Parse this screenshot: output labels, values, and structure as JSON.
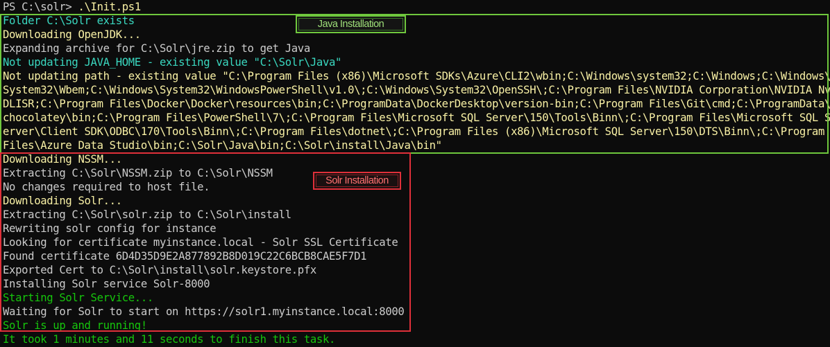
{
  "prompt": {
    "prefix": "PS C:\\solr> ",
    "command": ".\\Init.ps1"
  },
  "annotations": {
    "java_label": "Java Installation",
    "solr_label": "Solr Installation"
  },
  "output": [
    {
      "text": "Folder C:\\Solr exists",
      "color": "cyan"
    },
    {
      "text": "Downloading OpenJDK...",
      "color": "yellow"
    },
    {
      "text": "Expanding archive for C:\\Solr\\jre.zip to get Java",
      "color": "white"
    },
    {
      "text": "Not updating JAVA_HOME - existing value \"C:\\Solr\\Java\"",
      "color": "cyan"
    },
    {
      "text": "Not updating path - existing value \"C:\\Program Files (x86)\\Microsoft SDKs\\Azure\\CLI2\\wbin;C:\\Windows\\system32;C:\\Windows;C:\\Windows\\",
      "color": "yellow"
    },
    {
      "text": "System32\\Wbem;C:\\Windows\\System32\\WindowsPowerShell\\v1.0\\;C:\\Windows\\System32\\OpenSSH\\;C:\\Program Files\\NVIDIA Corporation\\NVIDIA Nv",
      "color": "yellow"
    },
    {
      "text": "DLISR;C:\\Program Files\\Docker\\Docker\\resources\\bin;C:\\ProgramData\\DockerDesktop\\version-bin;C:\\Program Files\\Git\\cmd;C:\\ProgramData\\",
      "color": "yellow"
    },
    {
      "text": "chocolatey\\bin;C:\\Program Files\\PowerShell\\7\\;C:\\Program Files\\Microsoft SQL Server\\150\\Tools\\Binn\\;C:\\Program Files\\Microsoft SQL S",
      "color": "yellow"
    },
    {
      "text": "erver\\Client SDK\\ODBC\\170\\Tools\\Binn\\;C:\\Program Files\\dotnet\\;C:\\Program Files (x86)\\Microsoft SQL Server\\150\\DTS\\Binn\\;C:\\Program",
      "color": "yellow"
    },
    {
      "text": "Files\\Azure Data Studio\\bin;C:\\Solr\\Java\\bin;C:\\Solr\\install\\Java\\bin\"",
      "color": "yellow"
    },
    {
      "text": "Downloading NSSM...",
      "color": "yellow"
    },
    {
      "text": "Extracting C:\\Solr\\NSSM.zip to C:\\Solr\\NSSM",
      "color": "white"
    },
    {
      "text": "No changes required to host file.",
      "color": "white"
    },
    {
      "text": "Downloading Solr...",
      "color": "yellow"
    },
    {
      "text": "Extracting C:\\Solr\\solr.zip to C:\\Solr\\install",
      "color": "white"
    },
    {
      "text": "Rewriting solr config for instance",
      "color": "white"
    },
    {
      "text": "Looking for certificate myinstance.local - Solr SSL Certificate",
      "color": "white"
    },
    {
      "text": "Found certificate 6D4D35D9E2A877892B8D019C22C6BCB8CAE5F7D1",
      "color": "white"
    },
    {
      "text": "Exported Cert to C:\\Solr\\install\\solr.keystore.pfx",
      "color": "white"
    },
    {
      "text": "Installing Solr service Solr-8000",
      "color": "white"
    },
    {
      "text": "Starting Solr Service...",
      "color": "green"
    },
    {
      "text": "Waiting for Solr to start on https://solr1.myinstance.local:8000",
      "color": "white"
    },
    {
      "text": "Solr is up and running!",
      "color": "green"
    },
    {
      "text": "It took 1 minutes and 11 seconds to finish this task.",
      "color": "green"
    }
  ]
}
